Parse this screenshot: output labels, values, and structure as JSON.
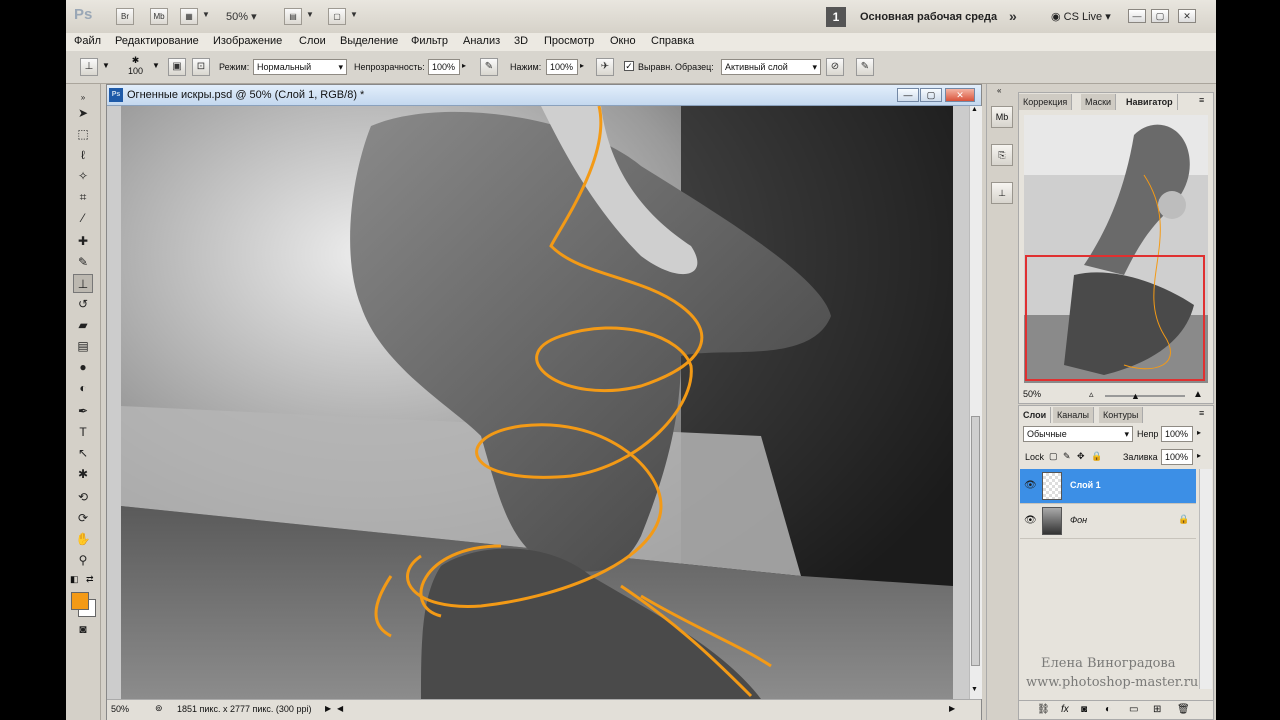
{
  "app": {
    "logo": "Ps",
    "bridge_btn": "Br",
    "minibridge_btn": "Mb",
    "zoom": "50%",
    "workspace_num": "1",
    "workspace_name": "Основная рабочая среда",
    "cs_live": "CS Live",
    "window_controls": [
      "—",
      "▢",
      "✕"
    ]
  },
  "menu": [
    "Файл",
    "Редактирование",
    "Изображение",
    "Слои",
    "Выделение",
    "Фильтр",
    "Анализ",
    "3D",
    "Просмотр",
    "Окно",
    "Справка"
  ],
  "options": {
    "brush_size": "100",
    "mode_label": "Режим:",
    "mode_value": "Нормальный",
    "opacity_label": "Непрозрачность:",
    "opacity_value": "100%",
    "flow_label": "Нажим:",
    "flow_value": "100%",
    "aligned_label": "Выравн.",
    "sample_label": "Образец:",
    "sample_value": "Активный слой"
  },
  "document": {
    "title": "Огненные искры.psd @ 50% (Слой 1, RGB/8) *",
    "status_zoom": "50%",
    "status_info": "1851 пикс. x 2777 пикс. (300 ppi)"
  },
  "navigator": {
    "tabs": [
      "Коррекция",
      "Маски",
      "Навигатор"
    ],
    "zoom": "50%"
  },
  "layers": {
    "tabs": [
      "Слои",
      "Каналы",
      "Контуры"
    ],
    "blend_mode": "Обычные",
    "opacity_label": "Непр",
    "opacity_value": "100%",
    "lock_label": "Lock",
    "fill_label": "Заливка",
    "fill_value": "100%",
    "items": [
      {
        "name": "Слой 1",
        "selected": true
      },
      {
        "name": "Фон",
        "selected": false
      }
    ]
  },
  "colors": {
    "foreground": "#f39a16",
    "background": "#ffffff",
    "accent": "#3c8fe6"
  },
  "watermark": {
    "author": "Елена Виноградова",
    "site": "www.photoshop-master.ru"
  }
}
